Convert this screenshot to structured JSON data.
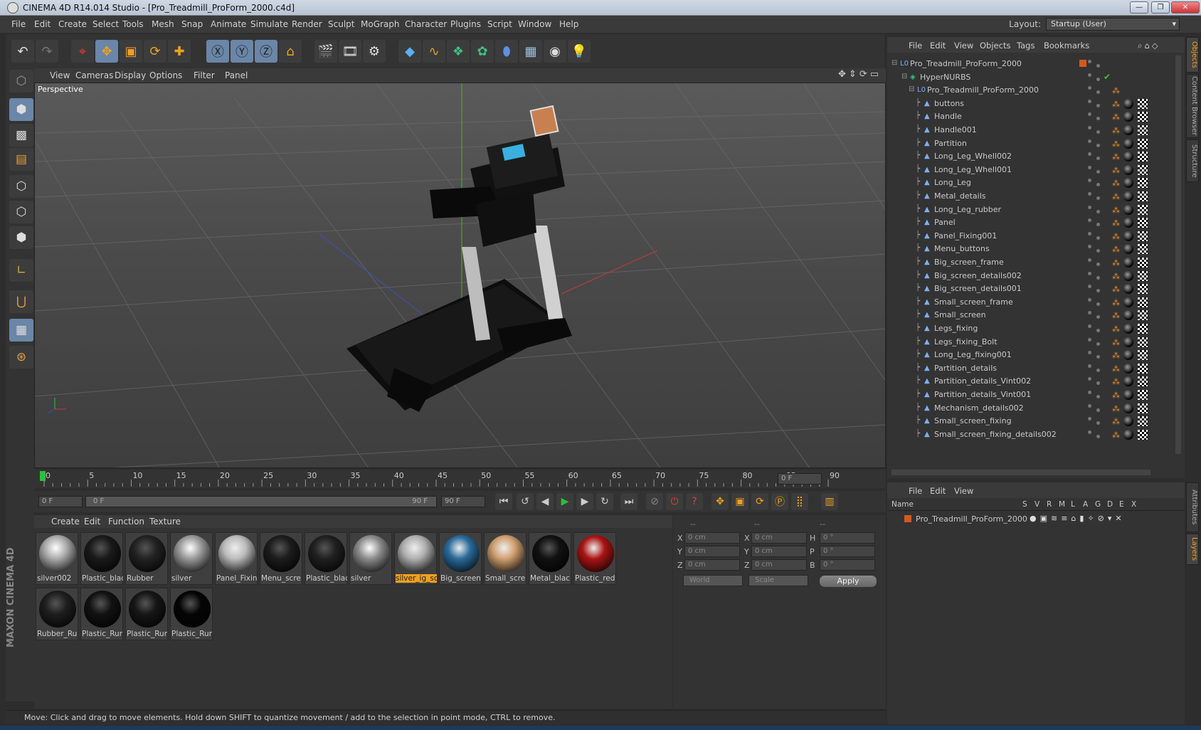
{
  "window": {
    "title": "CINEMA 4D R14.014 Studio - [Pro_Treadmill_ProForm_2000.c4d]",
    "min": "—",
    "max": "❐",
    "close": "✕"
  },
  "menubar": {
    "items": [
      "File",
      "Edit",
      "Create",
      "Select",
      "Tools",
      "Mesh",
      "Snap",
      "Animate",
      "Simulate",
      "Render",
      "Sculpt",
      "MoGraph",
      "Character",
      "Plugins",
      "Script",
      "Window",
      "Help"
    ],
    "layout_label": "Layout:",
    "layout_value": "Startup (User)"
  },
  "viewport": {
    "menu": [
      "View",
      "Cameras",
      "Display",
      "Options",
      "Filter",
      "Panel"
    ],
    "label": "Perspective"
  },
  "timeline": {
    "ticks": [
      "0",
      "5",
      "10",
      "15",
      "20",
      "25",
      "30",
      "35",
      "40",
      "45",
      "50",
      "55",
      "60",
      "65",
      "70",
      "75",
      "80",
      "85",
      "90"
    ],
    "current_frame": "0 F",
    "start_field": "0 F",
    "slider_start": "0 F",
    "slider_end": "90 F",
    "end_field": "90 F"
  },
  "materials": {
    "menu": [
      "Create",
      "Edit",
      "Function",
      "Texture"
    ],
    "items": [
      {
        "name": "silver002",
        "color": "#aaaaaa",
        "type": "metal"
      },
      {
        "name": "Plastic_blac",
        "color": "#1a1a1a",
        "type": "dark"
      },
      {
        "name": "Rubber",
        "color": "#222222",
        "type": "dark"
      },
      {
        "name": "silver",
        "color": "#999999",
        "type": "metal"
      },
      {
        "name": "Panel_Fixin",
        "color": "#bbbbbb",
        "type": "light"
      },
      {
        "name": "Menu_scre",
        "color": "#1c1c1c",
        "type": "dark"
      },
      {
        "name": "Plastic_blac",
        "color": "#202020",
        "type": "dark"
      },
      {
        "name": "silver",
        "color": "#8c8c8c",
        "type": "metal"
      },
      {
        "name": "silver_ig_sc",
        "color": "#b0b0b0",
        "type": "light",
        "selected": true
      },
      {
        "name": "Big_screen",
        "color": "#2a6a9a",
        "type": "screen"
      },
      {
        "name": "Small_scre",
        "color": "#d0a070",
        "type": "photo"
      },
      {
        "name": "Metal_blac",
        "color": "#111111",
        "type": "dark"
      },
      {
        "name": "Plastic_red",
        "color": "#aa1414",
        "type": "red"
      },
      {
        "name": "Rubber_Ru",
        "color": "#1e1e1e",
        "type": "dark"
      },
      {
        "name": "Plastic_Rur",
        "color": "#121212",
        "type": "dark"
      },
      {
        "name": "Plastic_Rur",
        "color": "#161616",
        "type": "dark"
      },
      {
        "name": "Plastic_Rur",
        "color": "#050505",
        "type": "dark"
      }
    ]
  },
  "coords": {
    "headers": [
      "--",
      "--",
      "--"
    ],
    "rows": [
      {
        "l1": "X",
        "v1": "0 cm",
        "l2": "X",
        "v2": "0 cm",
        "l3": "H",
        "v3": "0 °"
      },
      {
        "l1": "Y",
        "v1": "0 cm",
        "l2": "Y",
        "v2": "0 cm",
        "l3": "P",
        "v3": "0 °"
      },
      {
        "l1": "Z",
        "v1": "0 cm",
        "l2": "Z",
        "v2": "0 cm",
        "l3": "B",
        "v3": "0 °"
      }
    ],
    "mode1": "World",
    "mode2": "Scale",
    "apply": "Apply"
  },
  "status": "Move: Click and drag to move elements. Hold down SHIFT to quantize movement / add to the selection in point mode, CTRL to remove.",
  "brand": "MAXON CINEMA 4D",
  "objects": {
    "menu": [
      "File",
      "Edit",
      "View",
      "Objects",
      "Tags",
      "Bookmarks"
    ],
    "root": "Pro_Treadmill_ProForm_2000",
    "hypernurbs": "HyperNURBS",
    "group": "Pro_Treadmill_ProForm_2000",
    "children": [
      "buttons",
      "Handle",
      "Handle001",
      "Partition",
      "Long_Leg_Whell002",
      "Long_Leg_Whell001",
      "Long_Leg",
      "Metal_details",
      "Long_Leg_rubber",
      "Panel",
      "Panel_Fixing001",
      "Menu_buttons",
      "Big_screen_frame",
      "Big_screen_details002",
      "Big_screen_details001",
      "Small_screen_frame",
      "Small_screen",
      "Legs_fixing",
      "Legs_fixing_Bolt",
      "Long_Leg_fixing001",
      "Partition_details",
      "Partition_details_Vint002",
      "Partition_details_Vint001",
      "Mechanism_details002",
      "Small_screen_fixing",
      "Small_screen_fixing_details002"
    ]
  },
  "layers": {
    "menu": [
      "File",
      "Edit",
      "View"
    ],
    "columns": [
      "Name",
      "S",
      "V",
      "R",
      "M",
      "L",
      "A",
      "G",
      "D",
      "E",
      "X"
    ],
    "row": "Pro_Treadmill_ProForm_2000"
  },
  "side_tabs": [
    "Objects",
    "Content Browser",
    "Structure",
    "Attributes",
    "Layers"
  ]
}
